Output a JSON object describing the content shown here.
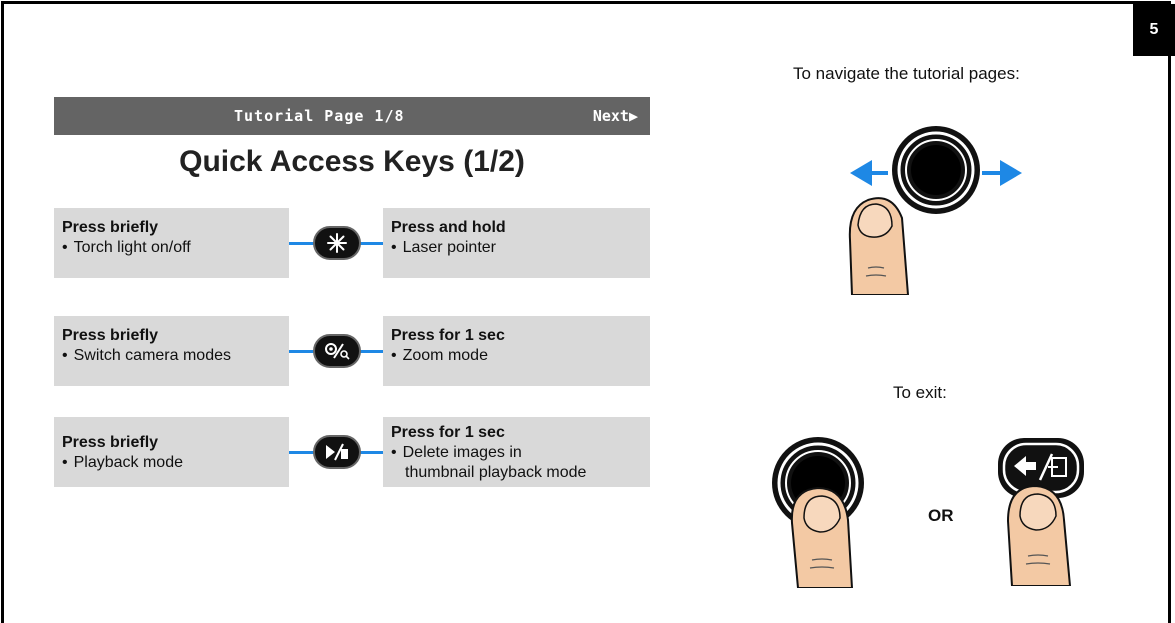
{
  "page_number": "5",
  "screen": {
    "header_page": "Tutorial Page 1/8",
    "header_next": "Next▶",
    "title": "Quick Access Keys (1/2)",
    "rows": [
      {
        "left_heading": "Press briefly",
        "left_items": [
          "Torch light on/off"
        ],
        "key_icon": "torch-key-icon",
        "right_heading": "Press and hold",
        "right_items": [
          "Laser pointer"
        ]
      },
      {
        "left_heading": "Press briefly",
        "left_items": [
          "Switch camera modes"
        ],
        "key_icon": "camera-zoom-key-icon",
        "right_heading": "Press for 1 sec",
        "right_items": [
          "Zoom mode"
        ]
      },
      {
        "left_heading": "Press briefly",
        "left_items": [
          "Playback mode"
        ],
        "key_icon": "playback-delete-key-icon",
        "right_heading": "Press for 1 sec",
        "right_items": [
          "Delete images in",
          "thumbnail playback mode"
        ]
      }
    ]
  },
  "navigate_caption": "To navigate the tutorial pages:",
  "exit_caption": "To exit:",
  "or_label": "OR",
  "colors": {
    "accent": "#1e88e5",
    "header_bg": "#646464",
    "cell_bg": "#d9d9d9"
  }
}
